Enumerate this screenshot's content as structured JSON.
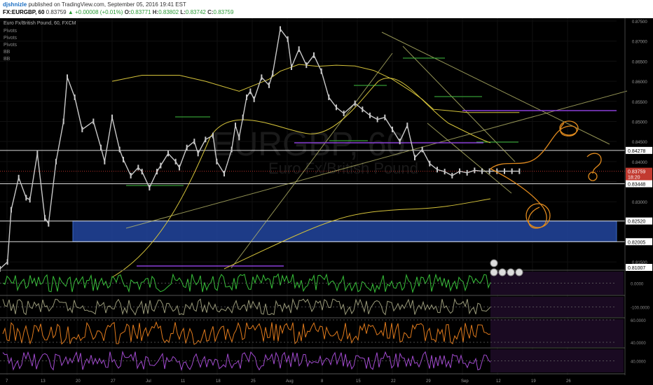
{
  "header": {
    "author": "djshnizle",
    "published": "published on TradingView.com, September 05, 2016 19:41 EST",
    "symbol": "FX:EURGBP, 60",
    "last": "0.83759",
    "change": "▲ +0.00008 (+0.01%)",
    "o_label": "O:",
    "o": "0.83771",
    "h_label": "H:",
    "h": "0.83802",
    "l_label": "L:",
    "l": "0.83742",
    "c_label": "C:",
    "c": "0.83759"
  },
  "legend": {
    "title": "Euro Fx/British Pound, 60, FXCM",
    "items": [
      "Pivots",
      "Pivots",
      "Pivots",
      "BB",
      "BB"
    ]
  },
  "watermark": {
    "main": "EURGBP, 60",
    "sub": "Euro Fx/British Pound"
  },
  "colors": {
    "background": "#000000",
    "candle": "#c8c8c8",
    "bollinger": "#d4c23a",
    "pivot": "#3fbf3f",
    "resistance_purple": "#8a3fd8",
    "zone": "#1f3f8f",
    "hand_drawn": "#e08a1e",
    "osc_green": "#38c23a",
    "osc_grey": "#9a9a7a",
    "osc_orange": "#e07a1c",
    "osc_purple": "#a24ad0"
  },
  "chart_data": {
    "type": "line",
    "title": "",
    "y_range": [
      0.8133,
      0.8757
    ],
    "y_ticks": [
      "0.87500",
      "0.87000",
      "0.86500",
      "0.86000",
      "0.85500",
      "0.85000",
      "0.84500",
      "0.84000",
      "0.83500",
      "0.83000",
      "0.82500",
      "0.82000",
      "0.81500"
    ],
    "x_ticks": [
      "7",
      "13",
      "20",
      "27",
      "Jul",
      "11",
      "18",
      "25",
      "Aug",
      "8",
      "15",
      "22",
      "29",
      "Sep",
      "12",
      "19",
      "26"
    ],
    "price_labels": [
      {
        "text": "0.84278",
        "value": 0.84278
      },
      {
        "text": "0.83759",
        "value": 0.83759,
        "current": true
      },
      {
        "text": "18:20",
        "value": 0.8362,
        "timer": true
      },
      {
        "text": "0.83448",
        "value": 0.83448
      },
      {
        "text": "0.82520",
        "value": 0.8252
      },
      {
        "text": "0.82005",
        "value": 0.82005
      },
      {
        "text": "0.81007",
        "value": 0.8133
      }
    ],
    "horizontal_levels": [
      0.84278,
      0.83448,
      0.8252,
      0.82005
    ],
    "zone": {
      "top": 0.8252,
      "bottom": 0.82005,
      "x_start": 0.18,
      "x_end": 1.0
    },
    "series": [
      {
        "name": "EURGBP",
        "x": [
          0,
          2,
          3,
          5,
          7,
          8,
          10,
          12,
          13,
          15,
          17,
          18,
          20,
          22,
          25,
          27,
          28,
          30,
          32,
          33,
          35,
          37,
          38,
          40,
          42,
          43,
          45,
          47,
          48,
          50,
          52,
          53,
          55,
          57,
          58,
          60,
          62,
          63,
          64,
          65,
          66,
          67,
          68,
          70,
          72,
          73,
          75,
          77,
          78,
          80,
          82,
          84,
          86,
          88,
          90,
          92,
          95,
          97,
          99,
          101,
          103,
          105,
          107,
          109,
          111,
          113,
          115,
          117,
          119,
          121,
          123,
          125,
          127,
          129,
          131,
          133,
          135,
          137,
          139
        ],
        "values": [
          0.7984,
          0.815,
          0.828,
          0.836,
          0.831,
          0.8305,
          0.842,
          0.826,
          0.8245,
          0.84,
          0.85,
          0.861,
          0.856,
          0.848,
          0.85,
          0.8435,
          0.84,
          0.851,
          0.843,
          0.8405,
          0.8365,
          0.8385,
          0.8375,
          0.8335,
          0.8375,
          0.839,
          0.842,
          0.84,
          0.8385,
          0.8435,
          0.845,
          0.842,
          0.8455,
          0.8465,
          0.84,
          0.837,
          0.843,
          0.849,
          0.846,
          0.851,
          0.856,
          0.8575,
          0.8555,
          0.861,
          0.859,
          0.862,
          0.873,
          0.8705,
          0.8635,
          0.868,
          0.864,
          0.8665,
          0.8625,
          0.856,
          0.8535,
          0.852,
          0.8545,
          0.853,
          0.8515,
          0.8505,
          0.851,
          0.848,
          0.845,
          0.849,
          0.841,
          0.843,
          0.8395,
          0.838,
          0.8375,
          0.8365,
          0.8376,
          0.8372,
          0.8378,
          0.8376,
          0.8376,
          0.8376,
          0.8376,
          0.8376,
          0.8376
        ]
      },
      {
        "name": "BB upper",
        "x": [
          30,
          38,
          48,
          55,
          64,
          72,
          75,
          80,
          85,
          90,
          95,
          100,
          105,
          110,
          113,
          116,
          120,
          125,
          130,
          135,
          139
        ],
        "values": [
          0.86,
          0.8615,
          0.8615,
          0.86,
          0.8575,
          0.8605,
          0.8625,
          0.8642,
          0.8637,
          0.864,
          0.8638,
          0.8627,
          0.8605,
          0.8575,
          0.8555,
          0.853,
          0.8527,
          0.8522,
          0.8522,
          0.8522,
          0.8522
        ]
      }
    ],
    "oscillators": [
      {
        "name": "",
        "color": "osc_green",
        "ticks": [
          "0.0000"
        ]
      },
      {
        "name": "",
        "color": "osc_grey",
        "ticks": [
          "-100.0000"
        ]
      },
      {
        "name": "",
        "color": "osc_orange",
        "ticks": [
          "60.0000",
          "40.0000"
        ]
      },
      {
        "name": "",
        "color": "osc_purple",
        "ticks": [
          "40.0000"
        ]
      }
    ]
  }
}
